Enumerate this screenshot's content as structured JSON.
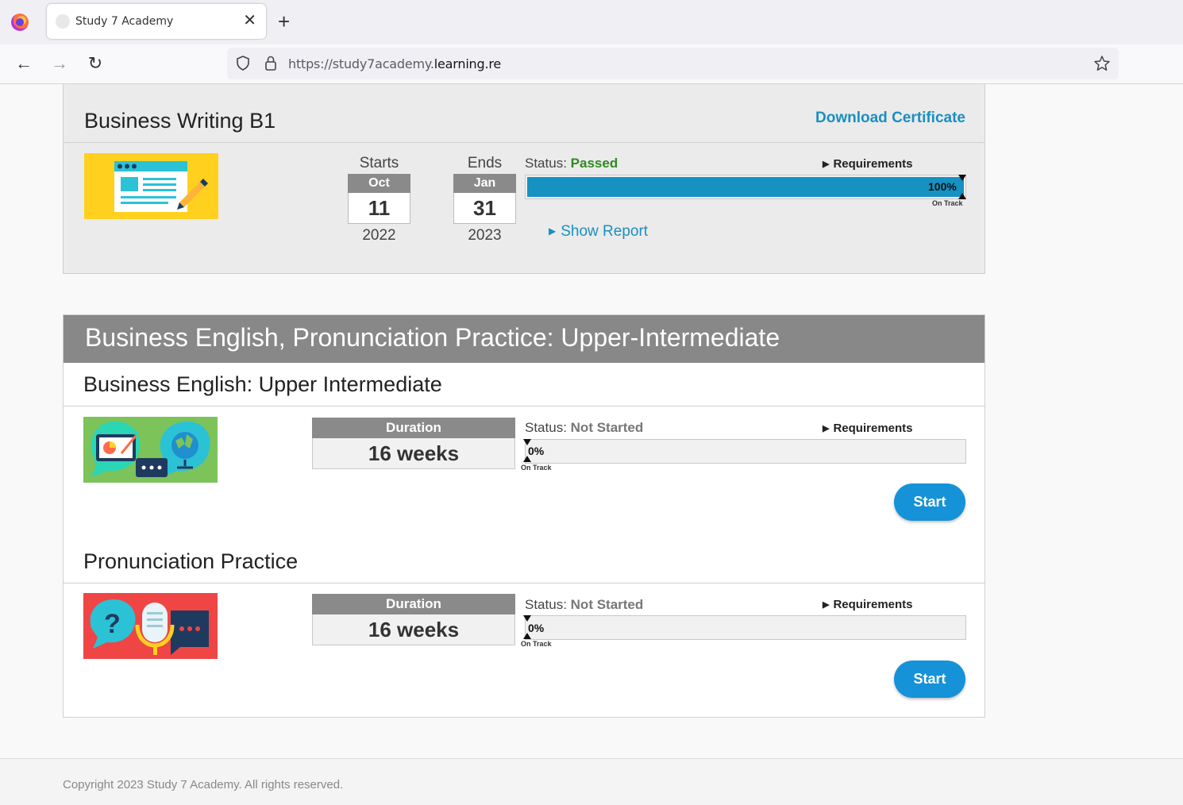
{
  "browser": {
    "tab_title": "Study 7 Academy",
    "tab_close": "✕",
    "new_tab": "+",
    "url_prefix": "https://study7academy.",
    "url_domain": "learning.re",
    "back_icon": "←",
    "forward_icon": "→",
    "reload_icon": "↻"
  },
  "course1": {
    "title": "Business Writing B1",
    "download_label": "Download Certificate",
    "starts": {
      "label": "Starts",
      "month": "Oct",
      "day": "11",
      "year": "2022"
    },
    "ends": {
      "label": "Ends",
      "month": "Jan",
      "day": "31",
      "year": "2023"
    },
    "status_label": "Status:",
    "status_value": "Passed",
    "requirements_label": "Requirements",
    "progress_label": "100%",
    "progress_fraction": 1.0,
    "ontrack_label": "On Track",
    "show_report_label": "Show Report",
    "thumb_color": "#ffd11e"
  },
  "program": {
    "title": "Business English, Pronunciation Practice: Upper-Intermediate",
    "courses": [
      {
        "title": "Business English: Upper Intermediate",
        "duration_label": "Duration",
        "duration_value": "16 weeks",
        "status_label": "Status:",
        "status_value": "Not Started",
        "requirements_label": "Requirements",
        "progress_label": "0%",
        "progress_fraction": 0,
        "ontrack_label": "On Track",
        "start_label": "Start",
        "thumb_color": "#7cc35a"
      },
      {
        "title": "Pronunciation Practice",
        "duration_label": "Duration",
        "duration_value": "16 weeks",
        "status_label": "Status:",
        "status_value": "Not Started",
        "requirements_label": "Requirements",
        "progress_label": "0%",
        "progress_fraction": 0,
        "ontrack_label": "On Track",
        "start_label": "Start",
        "thumb_color": "#ef4545"
      }
    ]
  },
  "footer": {
    "copyright": "Copyright 2023 Study 7 Academy. All rights reserved."
  },
  "colors": {
    "accent": "#1a8fc1",
    "progress": "#1592c2",
    "start_button": "#1592d8",
    "passed": "#2e8b1f"
  }
}
